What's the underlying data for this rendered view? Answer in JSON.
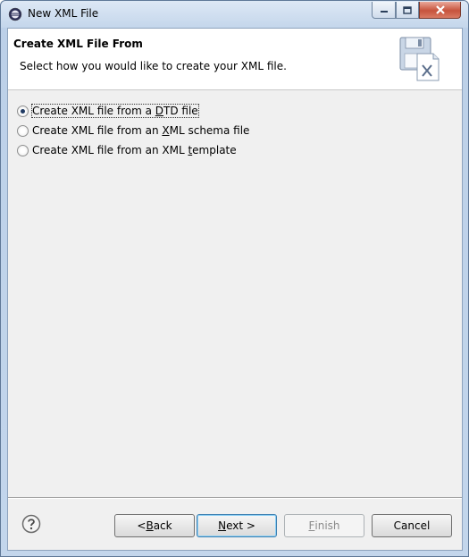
{
  "window": {
    "title": "New XML File"
  },
  "header": {
    "title": "Create XML File From",
    "description": "Select how you would like to create your XML file."
  },
  "options": [
    {
      "pre": "Create XML file from a ",
      "mnemonic": "D",
      "post": "TD file",
      "selected": true
    },
    {
      "pre": "Create XML file from an ",
      "mnemonic": "X",
      "post": "ML schema file",
      "selected": false
    },
    {
      "pre": "Create XML file from an XML ",
      "mnemonic": "t",
      "post": "emplate",
      "selected": false
    }
  ],
  "buttons": {
    "back": {
      "pre": "< ",
      "mnemonic": "B",
      "post": "ack"
    },
    "next": {
      "pre": "",
      "mnemonic": "N",
      "post": "ext >"
    },
    "finish": {
      "pre": "",
      "mnemonic": "F",
      "post": "inish",
      "enabled": false
    },
    "cancel": {
      "label": "Cancel"
    }
  },
  "icons": {
    "app": "eclipse-icon",
    "help": "help-icon",
    "banner": "xml-file-save-icon"
  }
}
